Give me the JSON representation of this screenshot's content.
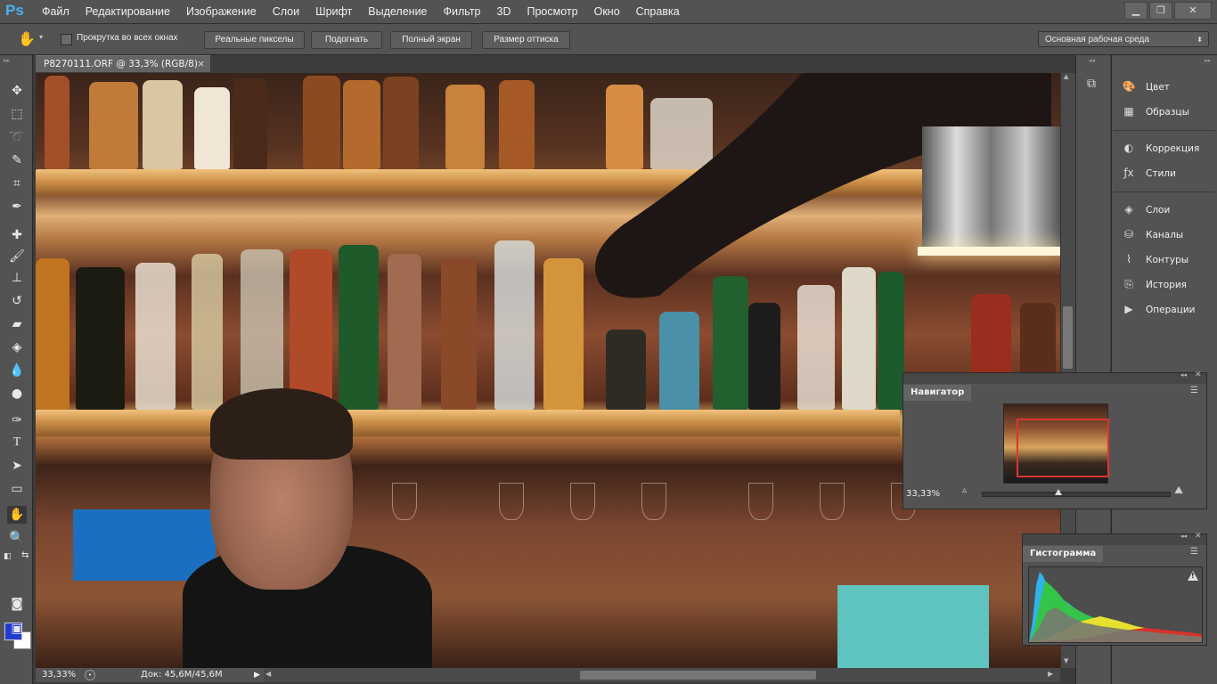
{
  "app": {
    "logo": "Ps"
  },
  "menu": [
    "Файл",
    "Редактирование",
    "Изображение",
    "Слои",
    "Шрифт",
    "Выделение",
    "Фильтр",
    "3D",
    "Просмотр",
    "Окно",
    "Справка"
  ],
  "window_controls": {
    "minimize": "▁",
    "restore": "❐",
    "close": "✕"
  },
  "options_bar": {
    "scroll_all_windows": "Прокрутка во всех окнах",
    "scroll_all_checked": false,
    "actual_pixels": "Реальные пикселы",
    "fit_screen": "Подогнать",
    "fill_screen": "Полный экран",
    "print_size": "Размер оттиска",
    "workspace": "Основная рабочая среда"
  },
  "document": {
    "tab_title": "P8270111.ORF @ 33,3% (RGB/8)",
    "close": "×"
  },
  "status": {
    "zoom": "33,33%",
    "doc_size": "Док: 45,6M/45,6M"
  },
  "colors": {
    "foreground": "#1f3cd1",
    "background": "#ffffff",
    "accent": "#4ab0f0"
  },
  "panels": {
    "group1": [
      {
        "icon": "palette-icon",
        "label": "Цвет"
      },
      {
        "icon": "grid-icon",
        "label": "Образцы"
      }
    ],
    "group2": [
      {
        "icon": "adjustments-icon",
        "label": "Коррекция"
      },
      {
        "icon": "fx-icon",
        "label": "Стили"
      }
    ],
    "group3": [
      {
        "icon": "layers-icon",
        "label": "Слои"
      },
      {
        "icon": "channels-icon",
        "label": "Каналы"
      },
      {
        "icon": "paths-icon",
        "label": "Контуры"
      },
      {
        "icon": "history-icon",
        "label": "История"
      },
      {
        "icon": "actions-icon",
        "label": "Операции"
      }
    ]
  },
  "navigator": {
    "title": "Навигатор",
    "zoom": "33,33%",
    "zoom_slider": 0.42
  },
  "histogram": {
    "title": "Гистограмма",
    "warning": "!"
  }
}
